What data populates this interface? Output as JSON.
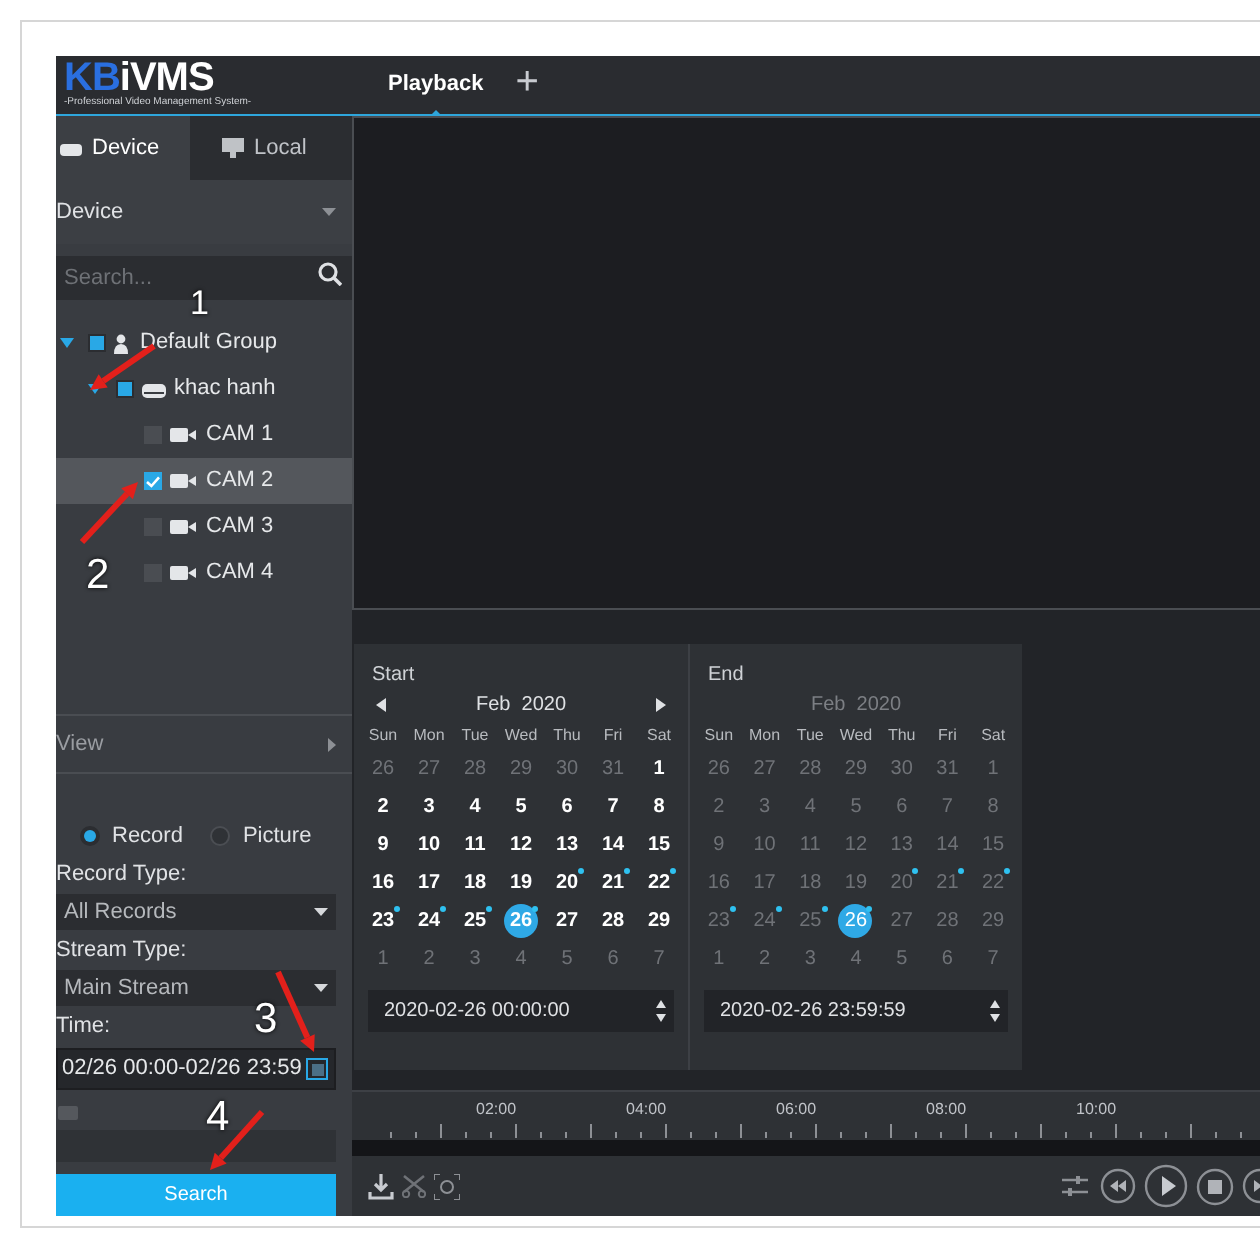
{
  "app": {
    "logo_prefix": "KB",
    "logo_name": "iVMS",
    "logo_subtitle": "-Professional Video Management System-"
  },
  "tabs": [
    {
      "label": "Playback",
      "selected": true
    }
  ],
  "add_tab": "+",
  "sidebar": {
    "tabs": [
      {
        "label": "Device",
        "selected": true,
        "kind": "device"
      },
      {
        "label": "Local",
        "selected": false,
        "kind": "local"
      }
    ],
    "dropdown": "Device",
    "search": {
      "placeholder": "Search..."
    },
    "tree": [
      {
        "label": "Default Group",
        "kind": "group",
        "expanded": true,
        "checked": false,
        "partial": true,
        "selected": false,
        "children": [
          {
            "label": "khac hanh",
            "kind": "device",
            "expanded": true,
            "checked": false,
            "partial": true,
            "selected": false,
            "children": [
              {
                "label": "CAM 1",
                "kind": "camera",
                "checked": false,
                "selected": false
              },
              {
                "label": "CAM 2",
                "kind": "camera",
                "checked": true,
                "selected": true
              },
              {
                "label": "CAM 3",
                "kind": "camera",
                "checked": false,
                "selected": false
              },
              {
                "label": "CAM 4",
                "kind": "camera",
                "checked": false,
                "selected": false
              }
            ]
          }
        ]
      }
    ],
    "view_label": "View",
    "source": [
      {
        "label": "Record",
        "selected": true
      },
      {
        "label": "Picture",
        "selected": false
      }
    ],
    "record_type_label": "Record Type:",
    "record_type": "All Records",
    "stream_type_label": "Stream Type:",
    "stream_type": "Main Stream",
    "time_label": "Time:",
    "time": "02/26 00:00-02/26 23:59",
    "search_button": "Search"
  },
  "calendars": [
    {
      "title": "Start",
      "month": "Feb",
      "year": "2020",
      "disabled": false,
      "time": "2020-02-26 00:00:00",
      "weekdays": [
        "Sun",
        "Mon",
        "Tue",
        "Wed",
        "Thu",
        "Fri",
        "Sat"
      ],
      "days": [
        {
          "d": "26",
          "kind": "other"
        },
        {
          "d": "27",
          "kind": "other"
        },
        {
          "d": "28",
          "kind": "other"
        },
        {
          "d": "29",
          "kind": "other"
        },
        {
          "d": "30",
          "kind": "other"
        },
        {
          "d": "31",
          "kind": "other"
        },
        {
          "d": "1",
          "kind": "current"
        },
        {
          "d": "2",
          "kind": "current"
        },
        {
          "d": "3",
          "kind": "current"
        },
        {
          "d": "4",
          "kind": "current"
        },
        {
          "d": "5",
          "kind": "current"
        },
        {
          "d": "6",
          "kind": "current"
        },
        {
          "d": "7",
          "kind": "current"
        },
        {
          "d": "8",
          "kind": "current"
        },
        {
          "d": "9",
          "kind": "current"
        },
        {
          "d": "10",
          "kind": "current"
        },
        {
          "d": "11",
          "kind": "current"
        },
        {
          "d": "12",
          "kind": "current"
        },
        {
          "d": "13",
          "kind": "current"
        },
        {
          "d": "14",
          "kind": "current"
        },
        {
          "d": "15",
          "kind": "current"
        },
        {
          "d": "16",
          "kind": "current"
        },
        {
          "d": "17",
          "kind": "current"
        },
        {
          "d": "18",
          "kind": "current"
        },
        {
          "d": "19",
          "kind": "current"
        },
        {
          "d": "20",
          "kind": "current",
          "record": true
        },
        {
          "d": "21",
          "kind": "current",
          "record": true
        },
        {
          "d": "22",
          "kind": "current",
          "record": true
        },
        {
          "d": "23",
          "kind": "current",
          "record": true
        },
        {
          "d": "24",
          "kind": "current",
          "record": true
        },
        {
          "d": "25",
          "kind": "current",
          "record": true
        },
        {
          "d": "26",
          "kind": "current",
          "record": true,
          "selected": true
        },
        {
          "d": "27",
          "kind": "current"
        },
        {
          "d": "28",
          "kind": "current"
        },
        {
          "d": "29",
          "kind": "current"
        },
        {
          "d": "1",
          "kind": "other"
        },
        {
          "d": "2",
          "kind": "other"
        },
        {
          "d": "3",
          "kind": "other"
        },
        {
          "d": "4",
          "kind": "other"
        },
        {
          "d": "5",
          "kind": "other"
        },
        {
          "d": "6",
          "kind": "other"
        },
        {
          "d": "7",
          "kind": "other"
        }
      ]
    },
    {
      "title": "End",
      "month": "Feb",
      "year": "2020",
      "disabled": true,
      "time": "2020-02-26 23:59:59",
      "weekdays": [
        "Sun",
        "Mon",
        "Tue",
        "Wed",
        "Thu",
        "Fri",
        "Sat"
      ],
      "days": [
        {
          "d": "26",
          "kind": "other"
        },
        {
          "d": "27",
          "kind": "other"
        },
        {
          "d": "28",
          "kind": "other"
        },
        {
          "d": "29",
          "kind": "other"
        },
        {
          "d": "30",
          "kind": "other"
        },
        {
          "d": "31",
          "kind": "other"
        },
        {
          "d": "1",
          "kind": "current"
        },
        {
          "d": "2",
          "kind": "current"
        },
        {
          "d": "3",
          "kind": "current"
        },
        {
          "d": "4",
          "kind": "current"
        },
        {
          "d": "5",
          "kind": "current"
        },
        {
          "d": "6",
          "kind": "current"
        },
        {
          "d": "7",
          "kind": "current"
        },
        {
          "d": "8",
          "kind": "current"
        },
        {
          "d": "9",
          "kind": "current"
        },
        {
          "d": "10",
          "kind": "current"
        },
        {
          "d": "11",
          "kind": "current"
        },
        {
          "d": "12",
          "kind": "current"
        },
        {
          "d": "13",
          "kind": "current"
        },
        {
          "d": "14",
          "kind": "current"
        },
        {
          "d": "15",
          "kind": "current"
        },
        {
          "d": "16",
          "kind": "current"
        },
        {
          "d": "17",
          "kind": "current"
        },
        {
          "d": "18",
          "kind": "current"
        },
        {
          "d": "19",
          "kind": "current"
        },
        {
          "d": "20",
          "kind": "current",
          "record": true
        },
        {
          "d": "21",
          "kind": "current",
          "record": true
        },
        {
          "d": "22",
          "kind": "current",
          "record": true
        },
        {
          "d": "23",
          "kind": "current",
          "record": true
        },
        {
          "d": "24",
          "kind": "current",
          "record": true
        },
        {
          "d": "25",
          "kind": "current",
          "record": true
        },
        {
          "d": "26",
          "kind": "current",
          "record": true,
          "selected": true
        },
        {
          "d": "27",
          "kind": "current"
        },
        {
          "d": "28",
          "kind": "current"
        },
        {
          "d": "29",
          "kind": "current"
        },
        {
          "d": "1",
          "kind": "other"
        },
        {
          "d": "2",
          "kind": "other"
        },
        {
          "d": "3",
          "kind": "other"
        },
        {
          "d": "4",
          "kind": "other"
        },
        {
          "d": "5",
          "kind": "other"
        },
        {
          "d": "6",
          "kind": "other"
        },
        {
          "d": "7",
          "kind": "other"
        }
      ]
    }
  ],
  "timeline": {
    "labels": [
      "02:00",
      "04:00",
      "06:00",
      "08:00",
      "10:00"
    ]
  },
  "annotations": [
    {
      "label": "1"
    },
    {
      "label": "2"
    },
    {
      "label": "3"
    },
    {
      "label": "4"
    }
  ]
}
